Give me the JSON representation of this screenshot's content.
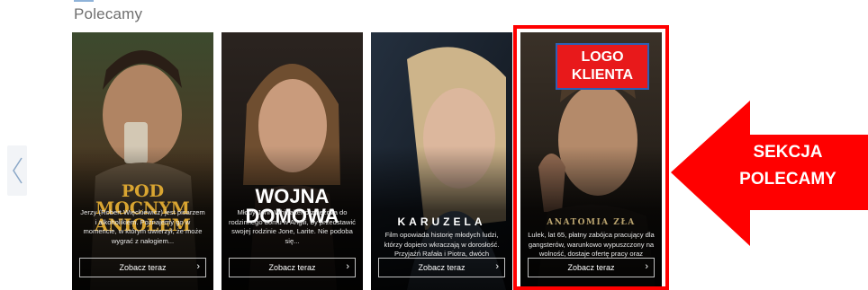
{
  "section": {
    "title": "Polecamy"
  },
  "carousel": {
    "prev_icon": "chevron-left-icon",
    "cards": [
      {
        "title_line1": "POD MOCNYM",
        "title_line2": "ANIOŁEM",
        "description": "Jerzy (Robert Więckiewicz) jest pisarzem i alkoholikiem. Poznajemy go w momencie, w którym uwierzył, że może wygrać z nałogiem...",
        "cta": "Zobacz teraz"
      },
      {
        "title_line1": "WOJNA",
        "title_line2": "DOMOWA",
        "description": "Młody John Whittaker przyjeżdża do rodzinnego domu w Anglii, by przedstawić swojej rodzinie Jone, Larite. Nie podoba się...",
        "cta": "Zobacz teraz"
      },
      {
        "title_line1": "KARUZELA",
        "title_line2": "",
        "description": "Film opowiada historię młodych ludzi, którzy dopiero wkraczają w dorosłość. Przyjaźń Rafała i Piotra, dwóch najlepszych przyjaciół ze...",
        "cta": "Zobacz teraz"
      },
      {
        "title_line1": "ANATOMIA ZŁA",
        "title_line2": "",
        "description": "Lulek, lat 65, płatny zabójca pracujący dla gangsterów, warunkowo wypuszczony na wolność, dostaje ofertę pracy oraz snajperski...",
        "cta": "Zobacz teraz"
      }
    ]
  },
  "annotations": {
    "logo_line1": "LOGO",
    "logo_line2": "KLIENTA",
    "callout_line1": "SEKCJA",
    "callout_line2": "POLECAMY",
    "accent_color": "#ff0000"
  }
}
